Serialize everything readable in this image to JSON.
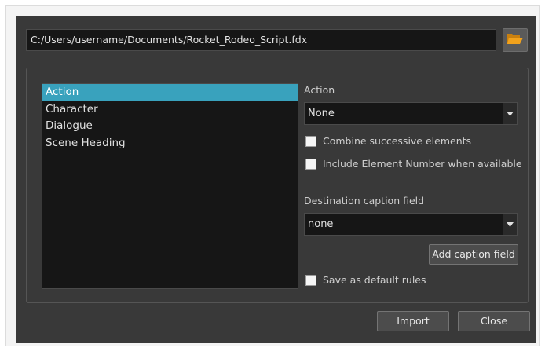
{
  "file": {
    "path": "C:/Users/username/Documents/Rocket_Rodeo_Script.fdx",
    "browse_icon": "folder-open-icon"
  },
  "elements_list": {
    "items": [
      "Action",
      "Character",
      "Dialogue",
      "Scene Heading"
    ],
    "selected": "Action"
  },
  "action_section": {
    "label": "Action",
    "selected_value": "None",
    "combine_label": "Combine successive elements",
    "combine_checked": false,
    "include_number_label": "Include Element Number when available",
    "include_number_checked": false
  },
  "destination_section": {
    "label": "Destination caption field",
    "selected_value": "none",
    "add_button_label": "Add caption field"
  },
  "save_default": {
    "label": "Save as default rules",
    "checked": false
  },
  "footer": {
    "import_label": "Import",
    "close_label": "Close"
  },
  "colors": {
    "dialog_bg": "#393939",
    "field_bg": "#161616",
    "selection": "#39a2bd",
    "folder_icon": "#f2a21c"
  }
}
